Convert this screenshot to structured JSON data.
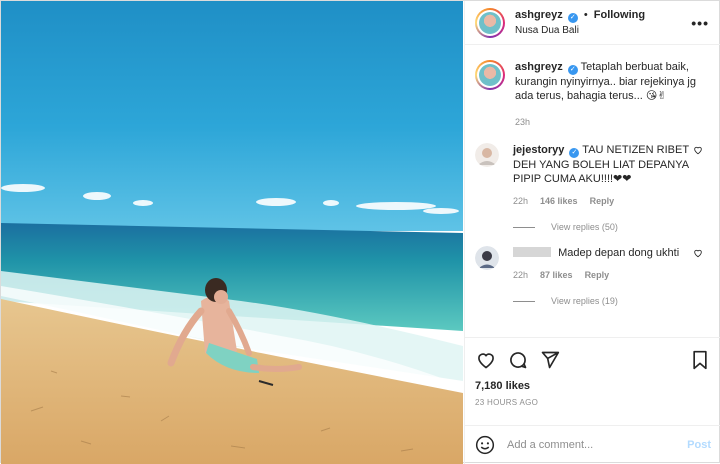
{
  "post": {
    "username": "ashgreyz",
    "follow_label": "Following",
    "location": "Nusa Dua Bali",
    "more_label": "•••"
  },
  "caption": {
    "username": "ashgreyz",
    "text": "Tetaplah berbuat baik, kurangin nyinyirnya.. biar rejekinya jg ada terus, bahagia terus... 😘✌",
    "time": "23h"
  },
  "comments": [
    {
      "username": "jejestoryy",
      "text": "TAU NETIZEN RIBET DEH YANG BOLEH LIAT DEPANYA PIPIP CUMA AKU!!!!❤❤",
      "time": "22h",
      "likes": "146 likes",
      "reply_label": "Reply",
      "view_replies": "View replies (50)"
    },
    {
      "username": "",
      "text": "Madep depan dong ukhti",
      "time": "22h",
      "likes": "87 likes",
      "reply_label": "Reply",
      "view_replies": "View replies (19)"
    }
  ],
  "stats": {
    "likes": "7,180 likes",
    "posted_ago": "23 HOURS AGO"
  },
  "composer": {
    "placeholder": "Add a comment...",
    "post_label": "Post"
  },
  "icons": {
    "like": "heart-icon",
    "comment": "comment-icon",
    "share": "send-icon",
    "save": "bookmark-icon",
    "emoji": "emoji-icon",
    "verified": "verified-badge-icon"
  },
  "colors": {
    "verified": "#3897f0",
    "post_disabled": "#b3dbff",
    "muted": "#8e8e8e",
    "heart_emoji": "#ed1c24"
  }
}
